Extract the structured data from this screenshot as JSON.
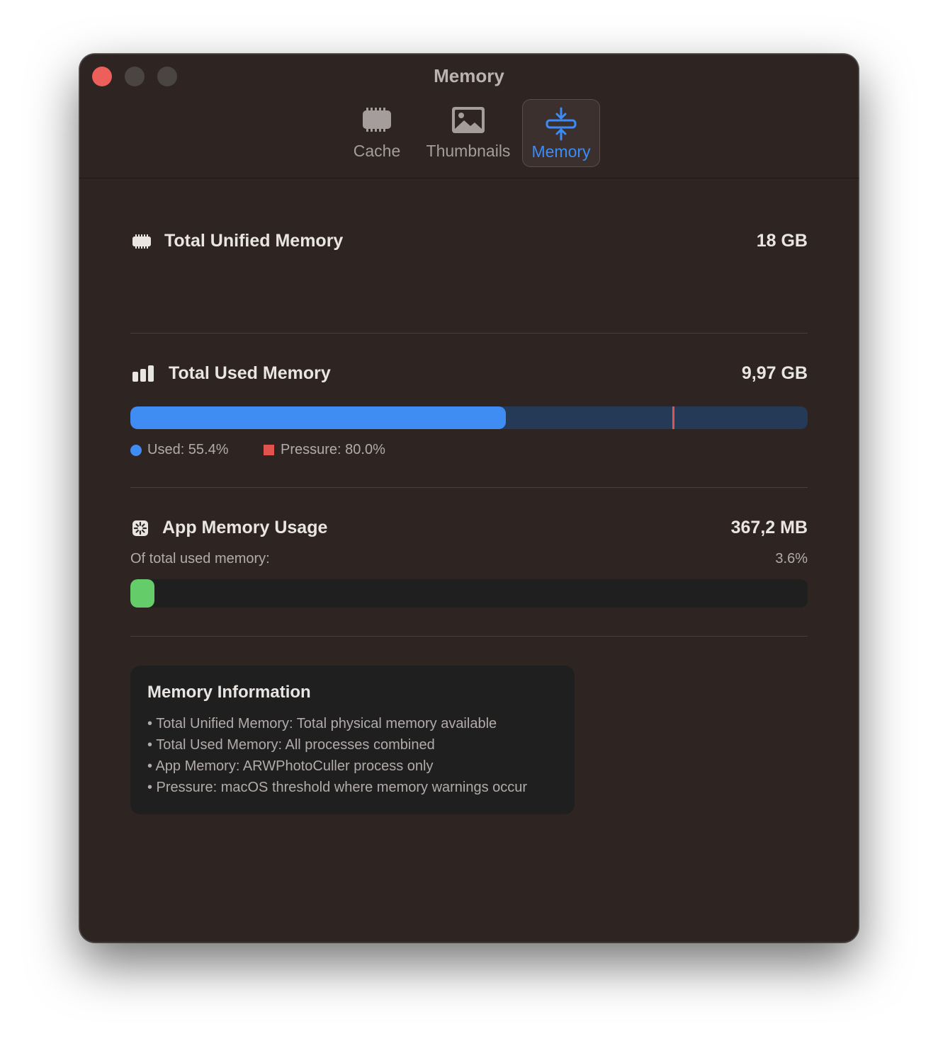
{
  "window": {
    "title": "Memory"
  },
  "tabs": [
    {
      "label": "Cache",
      "icon": "memory-chip-icon",
      "selected": false
    },
    {
      "label": "Thumbnails",
      "icon": "photo-icon",
      "selected": false
    },
    {
      "label": "Memory",
      "icon": "memory-compress-icon",
      "selected": true
    }
  ],
  "total_unified": {
    "label": "Total Unified Memory",
    "value": "18 GB",
    "icon": "memory-chip-icon"
  },
  "total_used": {
    "label": "Total Used Memory",
    "value": "9,97 GB",
    "icon": "bar-chart-icon",
    "used_fraction": 0.554,
    "pressure_fraction": 0.8,
    "legend_used": "Used: 55.4%",
    "legend_pressure": "Pressure: 80.0%",
    "used_color": "#3f8cf3",
    "pressure_color": "#e0534f"
  },
  "app_memory": {
    "label": "App Memory Usage",
    "value": "367,2 MB",
    "icon": "app-memory-icon",
    "sub_label": "Of total used memory:",
    "percent_text": "3.6%",
    "fraction": 0.036,
    "color": "#64cd6a"
  },
  "info": {
    "title": "Memory Information",
    "items": [
      "• Total Unified Memory: Total physical memory available",
      "• Total Used Memory: All processes combined",
      "• App Memory: ARWPhotoCuller process only",
      "• Pressure: macOS threshold where memory warnings occur"
    ]
  },
  "colors": {
    "accent": "#3b8cf6",
    "window_bg": "#2e2523"
  }
}
